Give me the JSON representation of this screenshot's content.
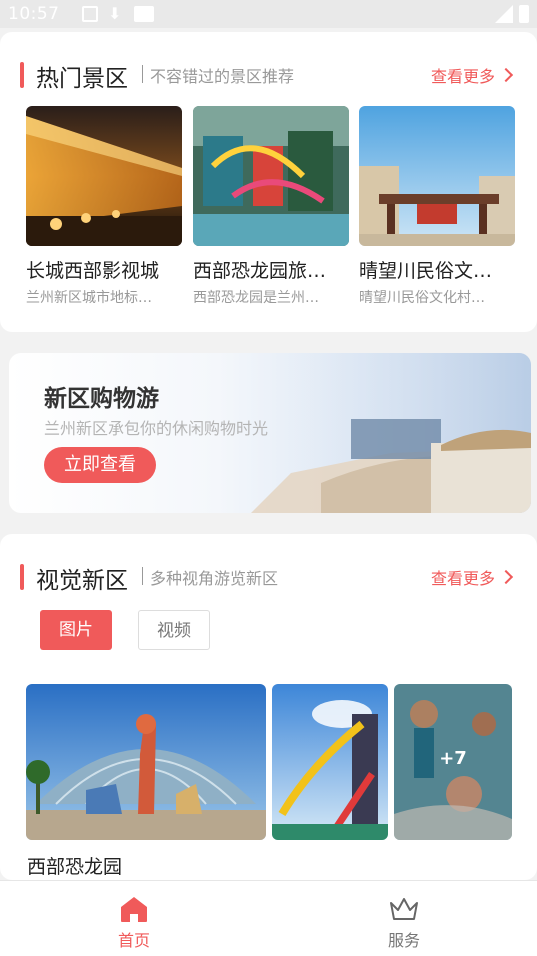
{
  "status_bar": {
    "time": "10:57"
  },
  "hot_spots": {
    "title": "热门景区",
    "subtitle": "不容错过的景区推荐",
    "more_label": "查看更多",
    "items": [
      {
        "name": "长城西部影视城",
        "desc": "兰州新区城市地标…"
      },
      {
        "name": "西部恐龙园旅…",
        "desc": "西部恐龙园是兰州…"
      },
      {
        "name": "晴望川民俗文…",
        "desc": "晴望川民俗文化村…"
      }
    ]
  },
  "banner": {
    "title": "新区购物游",
    "subtitle": "兰州新区承包你的休闲购物时光",
    "button_label": "立即查看"
  },
  "visual": {
    "title": "视觉新区",
    "subtitle": "多种视角游览新区",
    "more_label": "查看更多",
    "tabs": [
      {
        "label": "图片",
        "active": true
      },
      {
        "label": "视频",
        "active": false
      }
    ],
    "more_count": "+7",
    "gallery_title": "西部恐龙园"
  },
  "tabbar": {
    "items": [
      {
        "label": "首页",
        "icon": "home-icon",
        "active": true
      },
      {
        "label": "服务",
        "icon": "crown-icon",
        "active": false
      }
    ]
  },
  "colors": {
    "accent": "#f05a5a",
    "muted": "#999999"
  }
}
